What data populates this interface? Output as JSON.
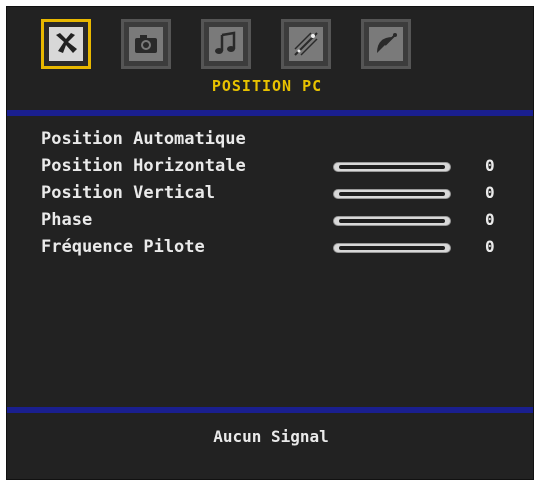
{
  "tabs": [
    {
      "icon": "picture-settings-icon",
      "active": true
    },
    {
      "icon": "camera-icon",
      "active": false
    },
    {
      "icon": "music-note-icon",
      "active": false
    },
    {
      "icon": "sparkle-icon",
      "active": false
    },
    {
      "icon": "satellite-dish-icon",
      "active": false
    }
  ],
  "menu": {
    "title": "POSITION PC",
    "items": [
      {
        "label": "Position Automatique"
      },
      {
        "label": "Position Horizontale",
        "value": "0",
        "level": 0
      },
      {
        "label": "Position Vertical",
        "value": "0",
        "level": 0
      },
      {
        "label": "Phase",
        "value": "0",
        "level": 0
      },
      {
        "label": "Fréquence Pilote",
        "value": "0",
        "level": 0
      }
    ]
  },
  "status": {
    "text": "Aucun Signal"
  },
  "colors": {
    "accent": "#e8c200",
    "divider": "#1a1f8f",
    "background": "#222222"
  }
}
